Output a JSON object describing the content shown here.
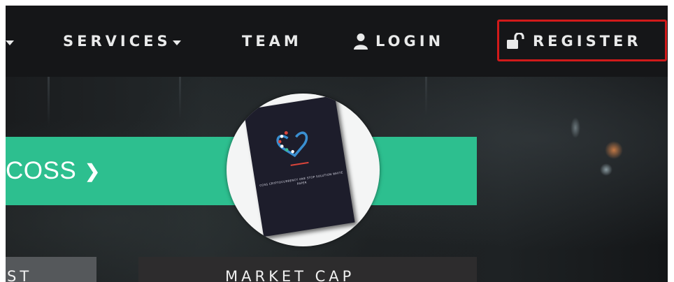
{
  "nav": {
    "services_label": "SERVICES",
    "team_label": "TEAM",
    "login_label": "LOGIN",
    "register_label": "REGISTER",
    "icons": {
      "login": "user-icon",
      "register": "unlock-icon"
    },
    "colors": {
      "background": "#151618",
      "text": "#e9eaea",
      "highlight_border": "#d11a1a"
    }
  },
  "hero": {
    "banner_text": "COSS",
    "banner_icon": "chevron-right-icon",
    "banner_color": "#2dbf8f",
    "book_title": "COSS CRYPTOCURRENCY ONE STOP SOLUTION WHITE PAPER"
  },
  "cards": {
    "left_label": "ST",
    "market_label": "MARKET CAP"
  }
}
